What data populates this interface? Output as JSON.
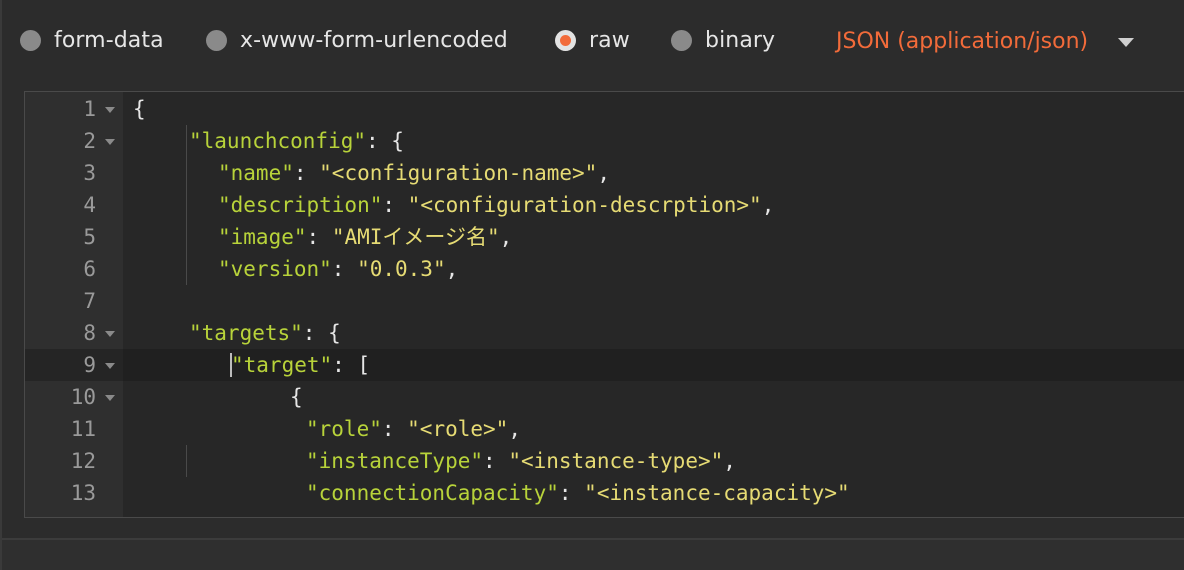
{
  "body_modes": [
    {
      "label": "form-data",
      "checked": false
    },
    {
      "label": "x-www-form-urlencoded",
      "checked": false
    },
    {
      "label": "raw",
      "checked": true
    },
    {
      "label": "binary",
      "checked": false
    }
  ],
  "content_type": {
    "selected": "JSON (application/json)",
    "icon": "chevron-down-icon"
  },
  "colors": {
    "accent": "#f26b3a",
    "key": "#b8d33a",
    "string": "#e6db74",
    "punctuation": "#e6e6e6"
  },
  "editor": {
    "active_line": 9,
    "lines": [
      {
        "number": "1",
        "foldable": true,
        "tokens": [
          {
            "t": "punc",
            "v": "{"
          }
        ]
      },
      {
        "number": "2",
        "foldable": true,
        "tokens": [
          {
            "t": "key",
            "v": "\"launchconfig\""
          },
          {
            "t": "punc",
            "v": ": {"
          }
        ]
      },
      {
        "number": "3",
        "foldable": false,
        "tokens": [
          {
            "t": "key",
            "v": "\"name\""
          },
          {
            "t": "punc",
            "v": ": "
          },
          {
            "t": "str",
            "v": "\"<configuration-name>\""
          },
          {
            "t": "punc",
            "v": ","
          }
        ]
      },
      {
        "number": "4",
        "foldable": false,
        "tokens": [
          {
            "t": "key",
            "v": "\"description\""
          },
          {
            "t": "punc",
            "v": ": "
          },
          {
            "t": "str",
            "v": "\"<configuration-descrption>\""
          },
          {
            "t": "punc",
            "v": ","
          }
        ]
      },
      {
        "number": "5",
        "foldable": false,
        "tokens": [
          {
            "t": "key",
            "v": "\"image\""
          },
          {
            "t": "punc",
            "v": ": "
          },
          {
            "t": "str",
            "v": "\"AMIイメージ名\""
          },
          {
            "t": "punc",
            "v": ","
          }
        ]
      },
      {
        "number": "6",
        "foldable": false,
        "tokens": [
          {
            "t": "key",
            "v": "\"version\""
          },
          {
            "t": "punc",
            "v": ": "
          },
          {
            "t": "str",
            "v": "\"0.0.3\""
          },
          {
            "t": "punc",
            "v": ","
          }
        ]
      },
      {
        "number": "7",
        "foldable": false,
        "tokens": []
      },
      {
        "number": "8",
        "foldable": true,
        "tokens": [
          {
            "t": "key",
            "v": "\"targets\""
          },
          {
            "t": "punc",
            "v": ": {"
          }
        ]
      },
      {
        "number": "9",
        "foldable": true,
        "tokens": [
          {
            "t": "key",
            "v": "\"target\""
          },
          {
            "t": "punc",
            "v": ": ["
          }
        ]
      },
      {
        "number": "10",
        "foldable": true,
        "tokens": [
          {
            "t": "punc",
            "v": "{"
          }
        ]
      },
      {
        "number": "11",
        "foldable": false,
        "tokens": [
          {
            "t": "key",
            "v": "\"role\""
          },
          {
            "t": "punc",
            "v": ": "
          },
          {
            "t": "str",
            "v": "\"<role>\""
          },
          {
            "t": "punc",
            "v": ","
          }
        ]
      },
      {
        "number": "12",
        "foldable": false,
        "tokens": [
          {
            "t": "key",
            "v": "\"instanceType\""
          },
          {
            "t": "punc",
            "v": ": "
          },
          {
            "t": "str",
            "v": "\"<instance-type>\""
          },
          {
            "t": "punc",
            "v": ","
          }
        ]
      },
      {
        "number": "13",
        "foldable": false,
        "tokens": [
          {
            "t": "key",
            "v": "\"connectionCapacity\""
          },
          {
            "t": "punc",
            "v": ": "
          },
          {
            "t": "str",
            "v": "\"<instance-capacity>\""
          }
        ]
      }
    ]
  }
}
